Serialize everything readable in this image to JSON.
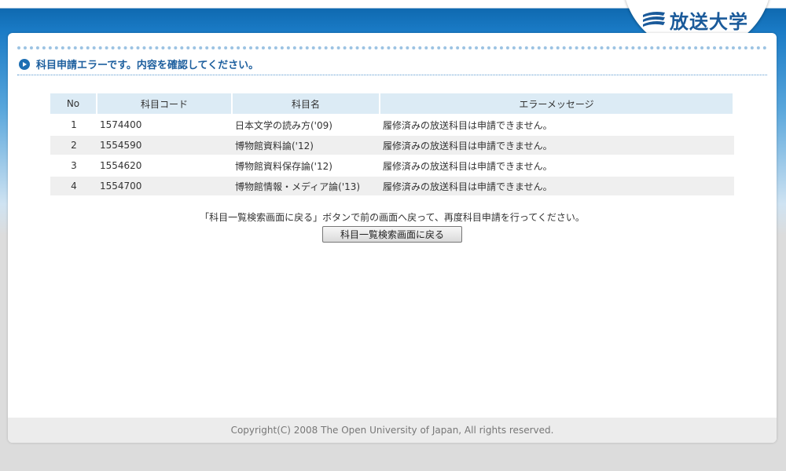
{
  "logo": {
    "text": "放送大学",
    "icon": "wave-logo-icon",
    "color": "#1a5a9a"
  },
  "header": {
    "title": "科目申請エラーです。内容を確認してください。",
    "icon": "play-circle-icon"
  },
  "table": {
    "columns": [
      "No",
      "科目コード",
      "科目名",
      "エラーメッセージ"
    ],
    "rows": [
      {
        "no": "1",
        "code": "1574400",
        "name": "日本文学の読み方('09)",
        "message": "履修済みの放送科目は申請できません。"
      },
      {
        "no": "2",
        "code": "1554590",
        "name": "博物館資料論('12)",
        "message": "履修済みの放送科目は申請できません。"
      },
      {
        "no": "3",
        "code": "1554620",
        "name": "博物館資料保存論('12)",
        "message": "履修済みの放送科目は申請できません。"
      },
      {
        "no": "4",
        "code": "1554700",
        "name": "博物館情報・メディア論('13)",
        "message": "履修済みの放送科目は申請できません。"
      }
    ]
  },
  "instruction": "「科目一覧検索画面に戻る」ボタンで前の画面へ戻って、再度科目申請を行ってください。",
  "back_button": {
    "label": "科目一覧検索画面に戻る"
  },
  "footer": {
    "copyright": "Copyright(C) 2008 The Open University of Japan, All rights reserved."
  },
  "colors": {
    "accent": "#1d6fb3",
    "header_bg": "#dcebf5",
    "title": "#1d5f9e"
  }
}
